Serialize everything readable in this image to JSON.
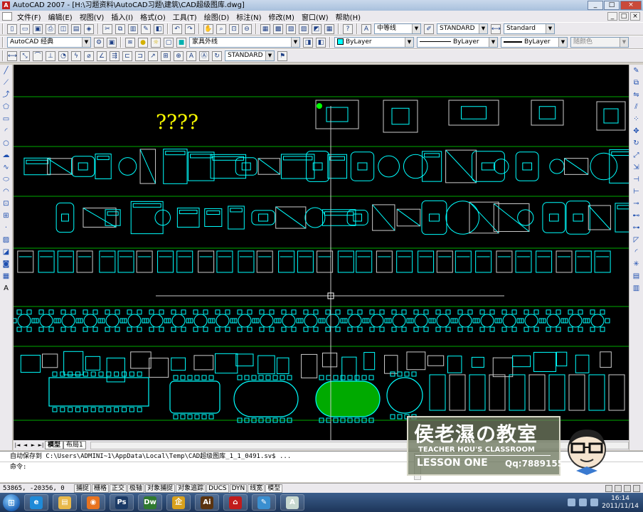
{
  "window": {
    "title": "AutoCAD 2007 - [H:\\习题资料\\AutoCAD习题\\建筑\\CAD超级图库.dwg]",
    "app_icon_letter": "A",
    "buttons": [
      "_",
      "□",
      "×"
    ]
  },
  "menubar": {
    "items": [
      "文件(F)",
      "编辑(E)",
      "视图(V)",
      "插入(I)",
      "格式(O)",
      "工具(T)",
      "绘图(D)",
      "标注(N)",
      "修改(M)",
      "窗口(W)",
      "帮助(H)"
    ],
    "mdi_buttons": [
      "_",
      "□",
      "×"
    ]
  },
  "toolbars": {
    "standard": {
      "linetype_combo": "中等线",
      "textstyle_combo": "STANDARD",
      "dimstyle_combo": "Standard"
    },
    "workspace_combo": "AutoCAD 经典",
    "layer_combo": "家具外线",
    "color_combo": "ByLayer",
    "linetype2_combo": "ByLayer",
    "lineweight_combo": "ByLayer",
    "plotstyle_combo": "随颜色",
    "dim_style_combo2": "STANDARD"
  },
  "drawing": {
    "annotation": "????",
    "background": "#000000",
    "line_color": "#00ffff",
    "grid_line_color": "#00aa00",
    "accent_green": "#00ff00",
    "crosshair_color": "#ffffff",
    "annotation_color": "#ffff00"
  },
  "layout_tabs": {
    "nav": [
      "|◄",
      "◄",
      "►",
      "►|"
    ],
    "tabs": [
      "模型",
      "布局1"
    ],
    "active": "模型"
  },
  "command": {
    "history": "自动保存到 C:\\Users\\ADMINI~1\\AppData\\Local\\Temp\\CAD超级图库_1_1_0491.sv$ ...",
    "prompt": "命令:"
  },
  "status": {
    "coords": "53865, -20356, 0",
    "toggles": [
      "捕捉",
      "栅格",
      "正交",
      "极轴",
      "对象捕捉",
      "对象追踪",
      "DUCS",
      "DYN",
      "线宽",
      "模型"
    ]
  },
  "taskbar": {
    "apps": [
      {
        "name": "ie",
        "label": "e",
        "color": "#1f8ad8"
      },
      {
        "name": "explorer",
        "label": "▤",
        "color": "#e8b84a"
      },
      {
        "name": "firefox",
        "label": "◉",
        "color": "#e8731f"
      },
      {
        "name": "photoshop",
        "label": "Ps",
        "color": "#1b3a66"
      },
      {
        "name": "dreamweaver",
        "label": "Dw",
        "color": "#2f7a2f"
      },
      {
        "name": "pdf-tool",
        "label": "企",
        "color": "#d9a11c"
      },
      {
        "name": "illustrator",
        "label": "Ai",
        "color": "#5a3310"
      },
      {
        "name": "acrobat",
        "label": "⌂",
        "color": "#c11c1c"
      },
      {
        "name": "notes",
        "label": "✎",
        "color": "#3a8fd0"
      },
      {
        "name": "autocad",
        "label": "A",
        "color": "#c8d8d0"
      }
    ],
    "time": "16:14",
    "date": "2011/11/14"
  },
  "watermark": {
    "title": "侯老濕の教室",
    "subtitle": "TEACHER HOU'S CLASSROOM",
    "lesson": "LESSON ONE",
    "qq": "Qq:7889155"
  }
}
